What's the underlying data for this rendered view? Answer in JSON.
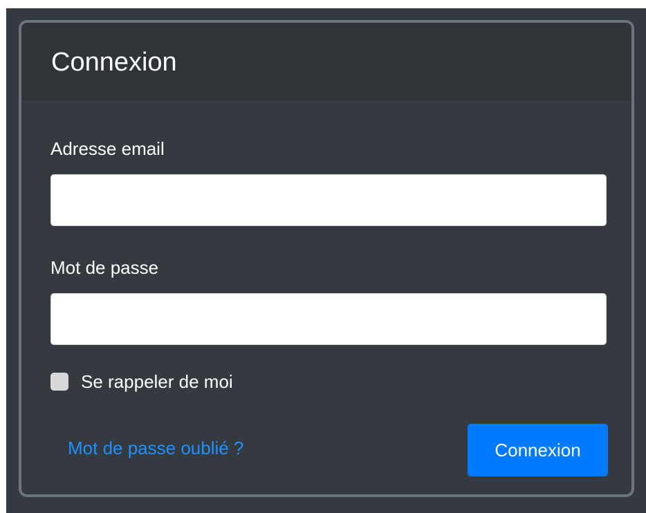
{
  "login": {
    "title": "Connexion",
    "email": {
      "label": "Adresse email",
      "value": "",
      "placeholder": ""
    },
    "password": {
      "label": "Mot de passe",
      "value": "",
      "placeholder": ""
    },
    "remember": {
      "label": "Se rappeler de moi",
      "checked": false
    },
    "forgot_link": "Mot de passe oublié ?",
    "submit_label": "Connexion"
  },
  "colors": {
    "card_background": "#343a40",
    "card_border": "#6c757d",
    "link": "#1e90ff",
    "primary_button": "#007bff"
  }
}
